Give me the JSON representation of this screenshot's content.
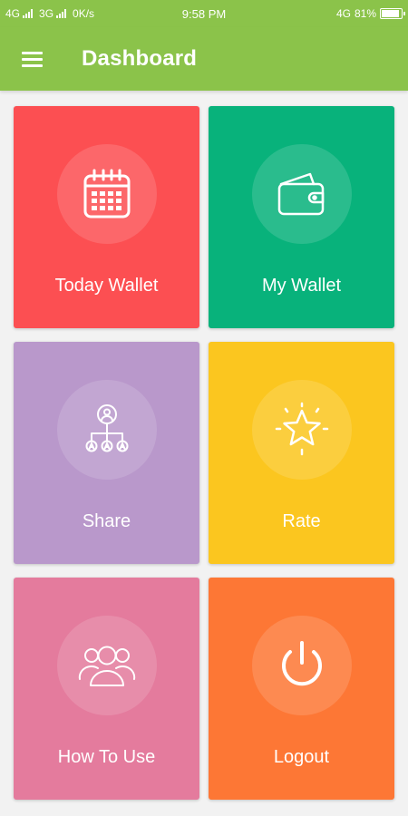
{
  "status_bar": {
    "network1": "4G",
    "network2": "3G",
    "speed": "0K/s",
    "time": "9:58 PM",
    "network3": "4G",
    "battery": "81%",
    "battery_level": 0.81
  },
  "app_bar": {
    "title": "Dashboard",
    "menu_icon": "hamburger-menu-icon",
    "color": "#8bc34a"
  },
  "tiles": [
    {
      "label": "Today Wallet",
      "icon": "calendar-icon",
      "color": "#fc4f52"
    },
    {
      "label": "My Wallet",
      "icon": "wallet-icon",
      "color": "#08b27b"
    },
    {
      "label": "Share",
      "icon": "share-network-icon",
      "color": "#b998cb"
    },
    {
      "label": "Rate",
      "icon": "star-icon",
      "color": "#fbc61f"
    },
    {
      "label": "How To Use",
      "icon": "users-group-icon",
      "color": "#e47b9d"
    },
    {
      "label": "Logout",
      "icon": "power-icon",
      "color": "#fd7735"
    }
  ]
}
